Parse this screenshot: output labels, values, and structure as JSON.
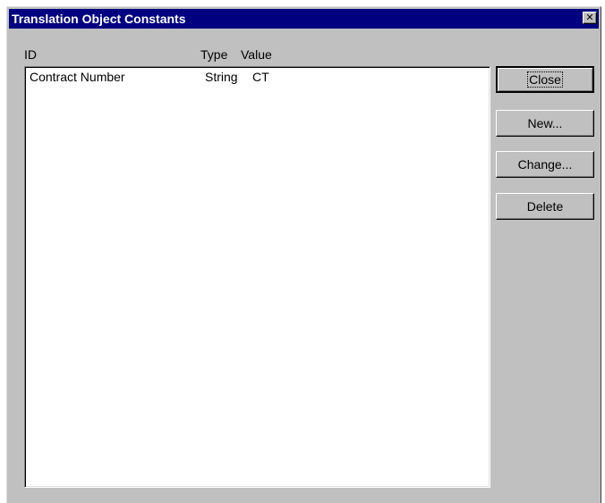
{
  "window": {
    "title": "Translation Object Constants",
    "close_glyph": "✕"
  },
  "list": {
    "columns": [
      "ID",
      "Type",
      "Value"
    ],
    "rows": [
      {
        "id": "Contract Number",
        "type": "String",
        "value": "CT"
      }
    ]
  },
  "buttons": {
    "close": "Close",
    "new": "New...",
    "change": "Change...",
    "delete": "Delete"
  },
  "colors": {
    "titlebar": "#000080",
    "face": "#c0c0c0"
  }
}
